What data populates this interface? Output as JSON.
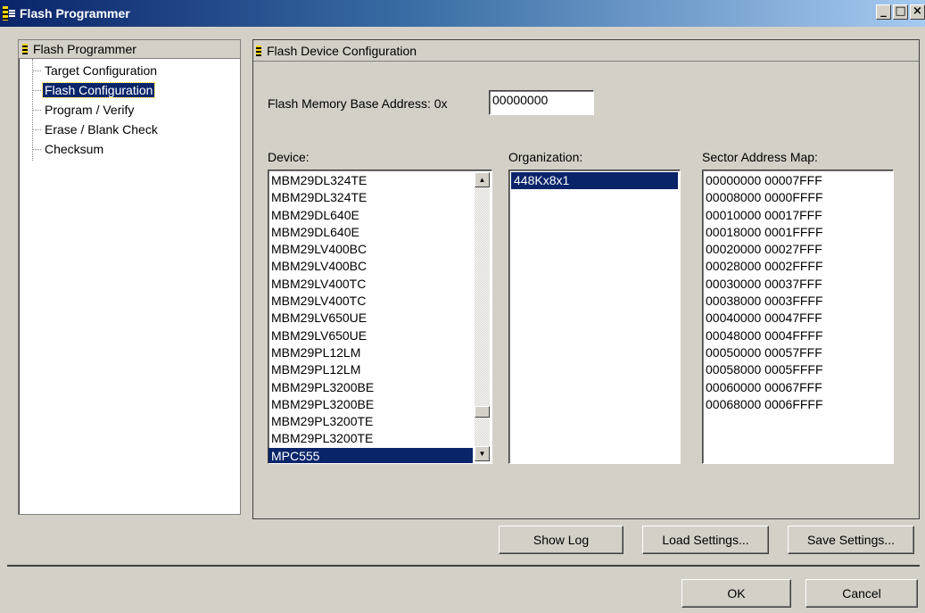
{
  "window": {
    "title": "Flash Programmer",
    "controls": [
      "_",
      "□",
      "×"
    ]
  },
  "tree": {
    "header": "Flash Programmer",
    "items": [
      {
        "label": "Target Configuration",
        "selected": false
      },
      {
        "label": "Flash Configuration",
        "selected": true
      },
      {
        "label": "Program / Verify",
        "selected": false
      },
      {
        "label": "Erase / Blank Check",
        "selected": false
      },
      {
        "label": "Checksum",
        "selected": false
      }
    ]
  },
  "config": {
    "header": "Flash Device Configuration",
    "base_address_label": "Flash Memory Base Address:  0x",
    "base_address_value": "00000000",
    "device_label": "Device:",
    "organization_label": "Organization:",
    "sector_map_label": "Sector Address Map:",
    "devices": [
      "MBM29DL324TE",
      "MBM29DL324TE",
      "MBM29DL640E",
      "MBM29DL640E",
      "MBM29LV400BC",
      "MBM29LV400BC",
      "MBM29LV400TC",
      "MBM29LV400TC",
      "MBM29LV650UE",
      "MBM29LV650UE",
      "MBM29PL12LM",
      "MBM29PL12LM",
      "MBM29PL3200BE",
      "MBM29PL3200BE",
      "MBM29PL3200TE",
      "MBM29PL3200TE",
      "MPC555"
    ],
    "selected_device": "MPC555",
    "organizations": [
      "448Kx8x1"
    ],
    "selected_organization": "448Kx8x1",
    "sector_map": [
      "00000000  00007FFF",
      "00008000  0000FFFF",
      "00010000  00017FFF",
      "00018000  0001FFFF",
      "00020000  00027FFF",
      "00028000  0002FFFF",
      "00030000  00037FFF",
      "00038000  0003FFFF",
      "00040000  00047FFF",
      "00048000  0004FFFF",
      "00050000  00057FFF",
      "00058000  0005FFFF",
      "00060000  00067FFF",
      "00068000  0006FFFF"
    ]
  },
  "buttons": {
    "show_log": "Show Log",
    "load_settings": "Load Settings...",
    "save_settings": "Save Settings...",
    "ok": "OK",
    "cancel": "Cancel"
  },
  "colors": {
    "selection": "#0a246a",
    "face": "#d4d0c8",
    "title_start": "#0a246a",
    "title_end": "#a6caf0"
  }
}
